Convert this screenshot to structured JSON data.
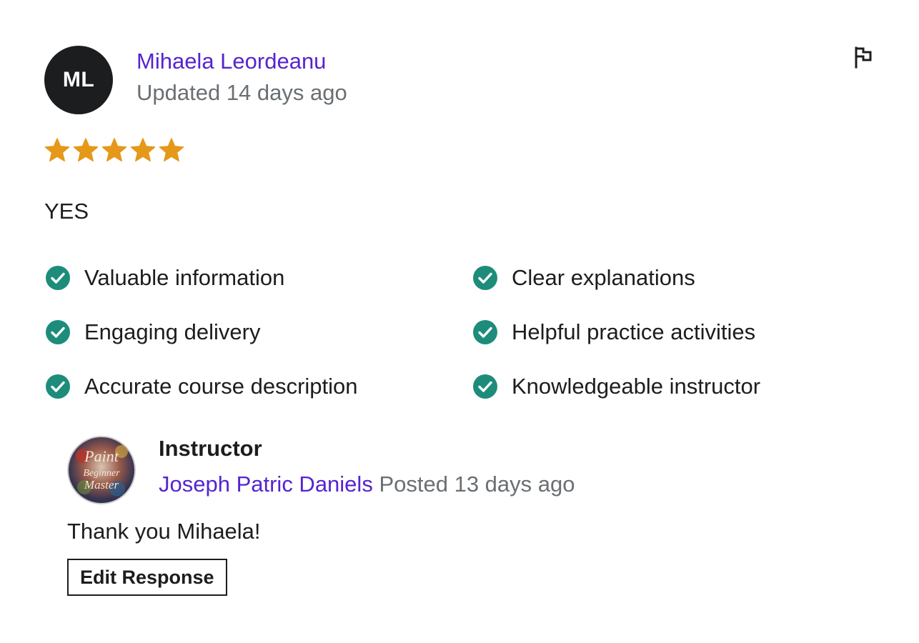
{
  "reviewer": {
    "initials": "ML",
    "name": "Mihaela Leordeanu",
    "updated": "Updated 14 days ago"
  },
  "rating": {
    "stars": 5,
    "max": 5,
    "color": "#e59819"
  },
  "review_text": "YES",
  "highlights": [
    {
      "label": "Valuable information"
    },
    {
      "label": "Clear explanations"
    },
    {
      "label": "Engaging delivery"
    },
    {
      "label": "Helpful practice activities"
    },
    {
      "label": "Accurate course description"
    },
    {
      "label": "Knowledgeable instructor"
    }
  ],
  "icons": {
    "flag": "flag-icon",
    "check": "check-circle-icon",
    "star": "star-icon"
  },
  "response": {
    "role": "Instructor",
    "instructor_name": "Joseph Patric Daniels",
    "posted": "Posted 13 days ago",
    "avatar_text": [
      "Paint",
      "Beginner",
      "Master"
    ],
    "text": "Thank you Mihaela!",
    "edit_label": "Edit Response"
  },
  "colors": {
    "accent": "#5624d0",
    "muted": "#6a6f73",
    "check": "#1e8c7a",
    "text": "#1c1d1f"
  }
}
